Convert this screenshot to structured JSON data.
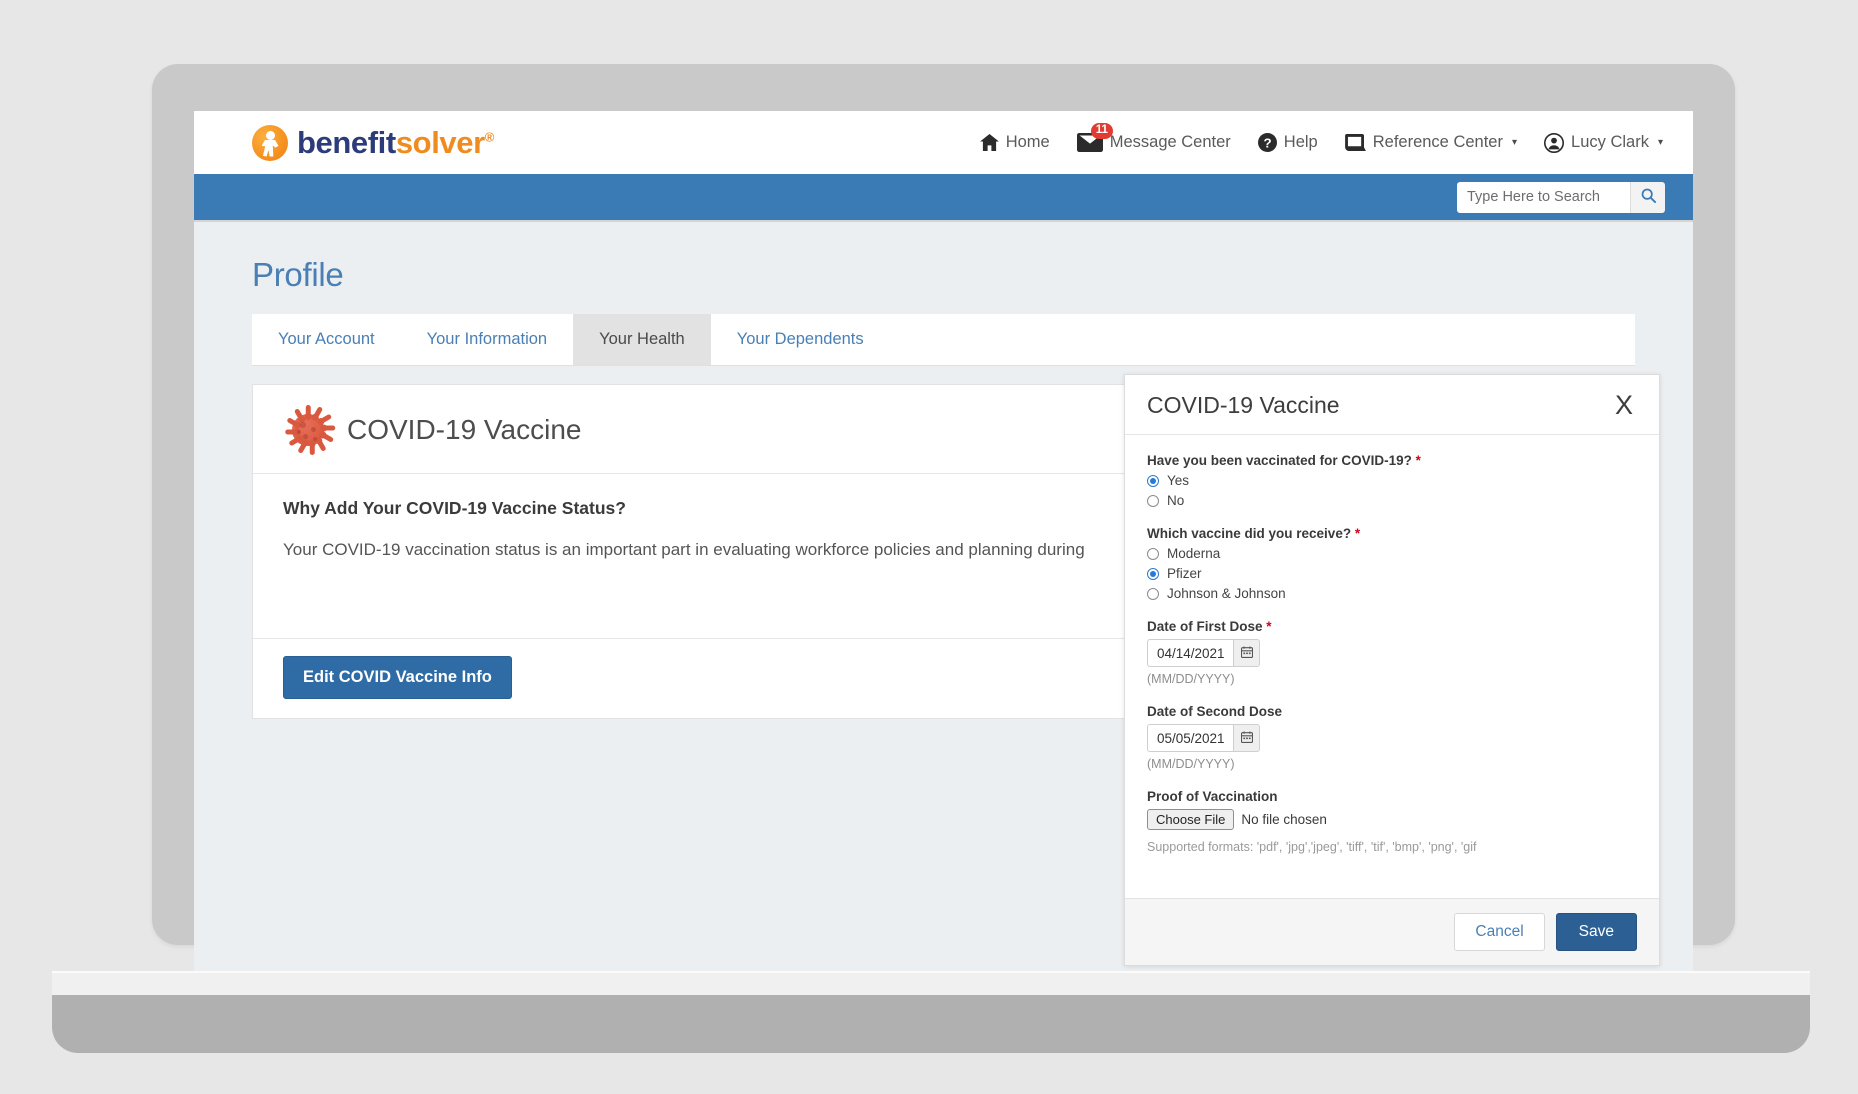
{
  "header": {
    "logo": {
      "part1": "benefit",
      "part2": "solver",
      "trademark": "®"
    },
    "nav": [
      {
        "label": "Home",
        "icon": "home-icon"
      },
      {
        "label": "Message Center",
        "icon": "envelope-icon",
        "badge": "11"
      },
      {
        "label": "Help",
        "icon": "question-circle-icon"
      },
      {
        "label": "Reference Center",
        "icon": "book-icon",
        "caret": "▾"
      },
      {
        "label": "Lucy Clark",
        "icon": "user-circle-icon",
        "caret": "▾"
      }
    ]
  },
  "search": {
    "placeholder": "Type Here to Search",
    "value": "",
    "icon": "search-icon"
  },
  "page": {
    "title": "Profile",
    "tabs": [
      {
        "label": "Your Account",
        "active": false
      },
      {
        "label": "Your Information",
        "active": false
      },
      {
        "label": "Your Health",
        "active": true
      },
      {
        "label": "Your Dependents",
        "active": false
      }
    ]
  },
  "card": {
    "icon": "coronavirus-icon",
    "title": "COVID-19 Vaccine",
    "subtitle": "Why Add Your COVID-19 Vaccine Status?",
    "text": "Your COVID-19 vaccination status is an important part in evaluating workforce policies and planning during",
    "edit_button": "Edit COVID Vaccine Info"
  },
  "modal": {
    "title": "COVID-19 Vaccine",
    "close_label": "X",
    "q1": {
      "label": "Have you been vaccinated for COVID-19?",
      "required": "*",
      "options": [
        {
          "label": "Yes",
          "checked": true
        },
        {
          "label": "No",
          "checked": false
        }
      ]
    },
    "q2": {
      "label": "Which vaccine did you receive?",
      "required": "*",
      "options": [
        {
          "label": "Moderna",
          "checked": false
        },
        {
          "label": "Pfizer",
          "checked": true
        },
        {
          "label": "Johnson & Johnson",
          "checked": false
        }
      ]
    },
    "first_dose": {
      "label": "Date of First Dose",
      "required": "*",
      "value": "04/14/2021",
      "hint": "(MM/DD/YYYY)",
      "icon": "calendar-icon"
    },
    "second_dose": {
      "label": "Date of Second Dose",
      "required": "",
      "value": "05/05/2021",
      "hint": "(MM/DD/YYYY)",
      "icon": "calendar-icon"
    },
    "proof": {
      "label": "Proof of Vaccination",
      "choose_file": "Choose File",
      "file_status": "No file chosen",
      "formats": "Supported formats: 'pdf', 'jpg','jpeg', 'tiff', 'tif', 'bmp', 'png', 'gif"
    },
    "cancel": "Cancel",
    "save": "Save"
  },
  "colors": {
    "brand_blue": "#3a7ab5",
    "brand_orange": "#f08c1f",
    "logo_navy": "#2c3b7a",
    "badge_red": "#e03c31",
    "required_red": "#d0021b",
    "radio_blue": "#2b7ad1",
    "save_blue": "#2c6095"
  }
}
